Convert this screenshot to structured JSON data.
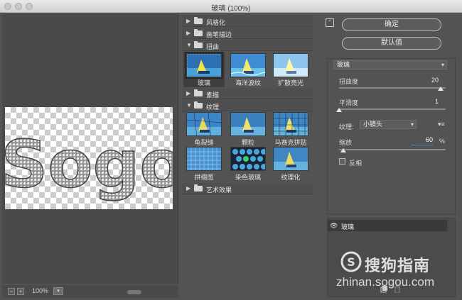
{
  "window": {
    "title": "玻璃 (100%)"
  },
  "preview": {
    "zoom": "100%",
    "zoom_minus": "−",
    "zoom_plus": "+",
    "dropdown": "▾",
    "canvas_text": "Sogou"
  },
  "gallery": {
    "folders": [
      {
        "label": "风格化",
        "expanded": false
      },
      {
        "label": "画笔描边",
        "expanded": false
      },
      {
        "label": "扭曲",
        "expanded": true
      },
      {
        "label": "素描",
        "expanded": false
      },
      {
        "label": "纹理",
        "expanded": true
      },
      {
        "label": "艺术效果",
        "expanded": false
      }
    ],
    "distort_filters": [
      "玻璃",
      "海洋波纹",
      "扩散亮光"
    ],
    "texture_filters": [
      "龟裂缝",
      "颗粒",
      "马赛克拼贴",
      "拼缀图",
      "染色玻璃",
      "纹理化"
    ],
    "selected": "玻璃"
  },
  "panel": {
    "ok_label": "确定",
    "default_label": "默认值",
    "filter_select": "玻璃",
    "distortion_label": "扭曲度",
    "distortion_value": "20",
    "distortion_fraction": 0.95,
    "smoothness_label": "平滑度",
    "smoothness_value": "1",
    "smoothness_fraction": 0.0,
    "texture_label": "纹理:",
    "texture_value": "小镜头",
    "scale_label": "缩放",
    "scale_value": "60",
    "scale_unit": "%",
    "scale_fraction": 0.04,
    "invert_label": "反相"
  },
  "layers": {
    "items": [
      {
        "name": "玻璃",
        "visible": true
      }
    ]
  },
  "watermark": {
    "brand": "搜狗指南",
    "url": "zhinan.sogou.com"
  }
}
